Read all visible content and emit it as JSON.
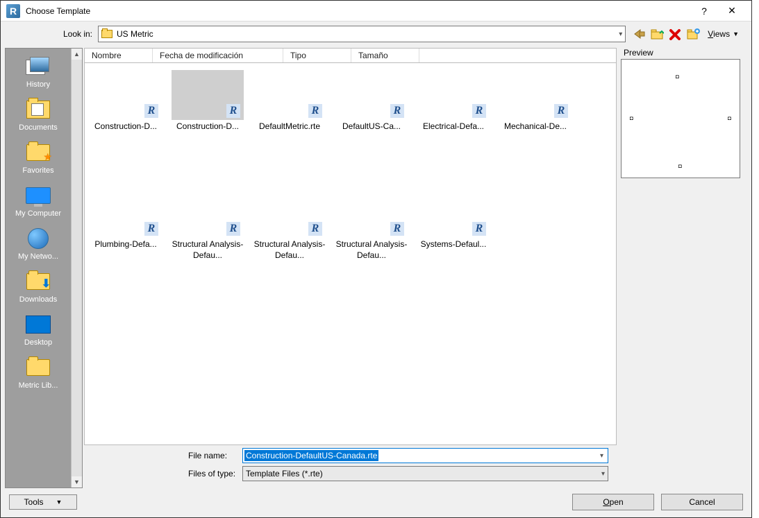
{
  "title": "Choose Template",
  "lookin_label": "Look in:",
  "lookin_value": "US Metric",
  "views_label": "Views",
  "preview_label": "Preview",
  "columns": {
    "c1": "Nombre",
    "c2": "Fecha de modificación",
    "c3": "Tipo",
    "c4": "Tamaño"
  },
  "places": {
    "history": "History",
    "documents": "Documents",
    "favorites": "Favorites",
    "mycomputer": "My Computer",
    "mynetwork": "My Netwo...",
    "downloads": "Downloads",
    "desktop": "Desktop",
    "metriclib": "Metric Lib..."
  },
  "files": {
    "f0": "Construction-D...",
    "f1": "Construction-D...",
    "f2": "DefaultMetric.rte",
    "f3": "DefaultUS-Ca...",
    "f4": "Electrical-Defa...",
    "f5": "Mechanical-De...",
    "f6": "Plumbing-Defa...",
    "f7": "Structural Analysis-Defau...",
    "f8": "Structural Analysis-Defau...",
    "f9": "Structural Analysis-Defau...",
    "f10": "Systems-Defaul..."
  },
  "filename_label": "File name:",
  "filename_value": "Construction-DefaultUS-Canada.rte",
  "filetype_label": "Files of type:",
  "filetype_value": "Template Files  (*.rte)",
  "tools_label": "Tools",
  "open_label": "Open",
  "cancel_label": "Cancel"
}
